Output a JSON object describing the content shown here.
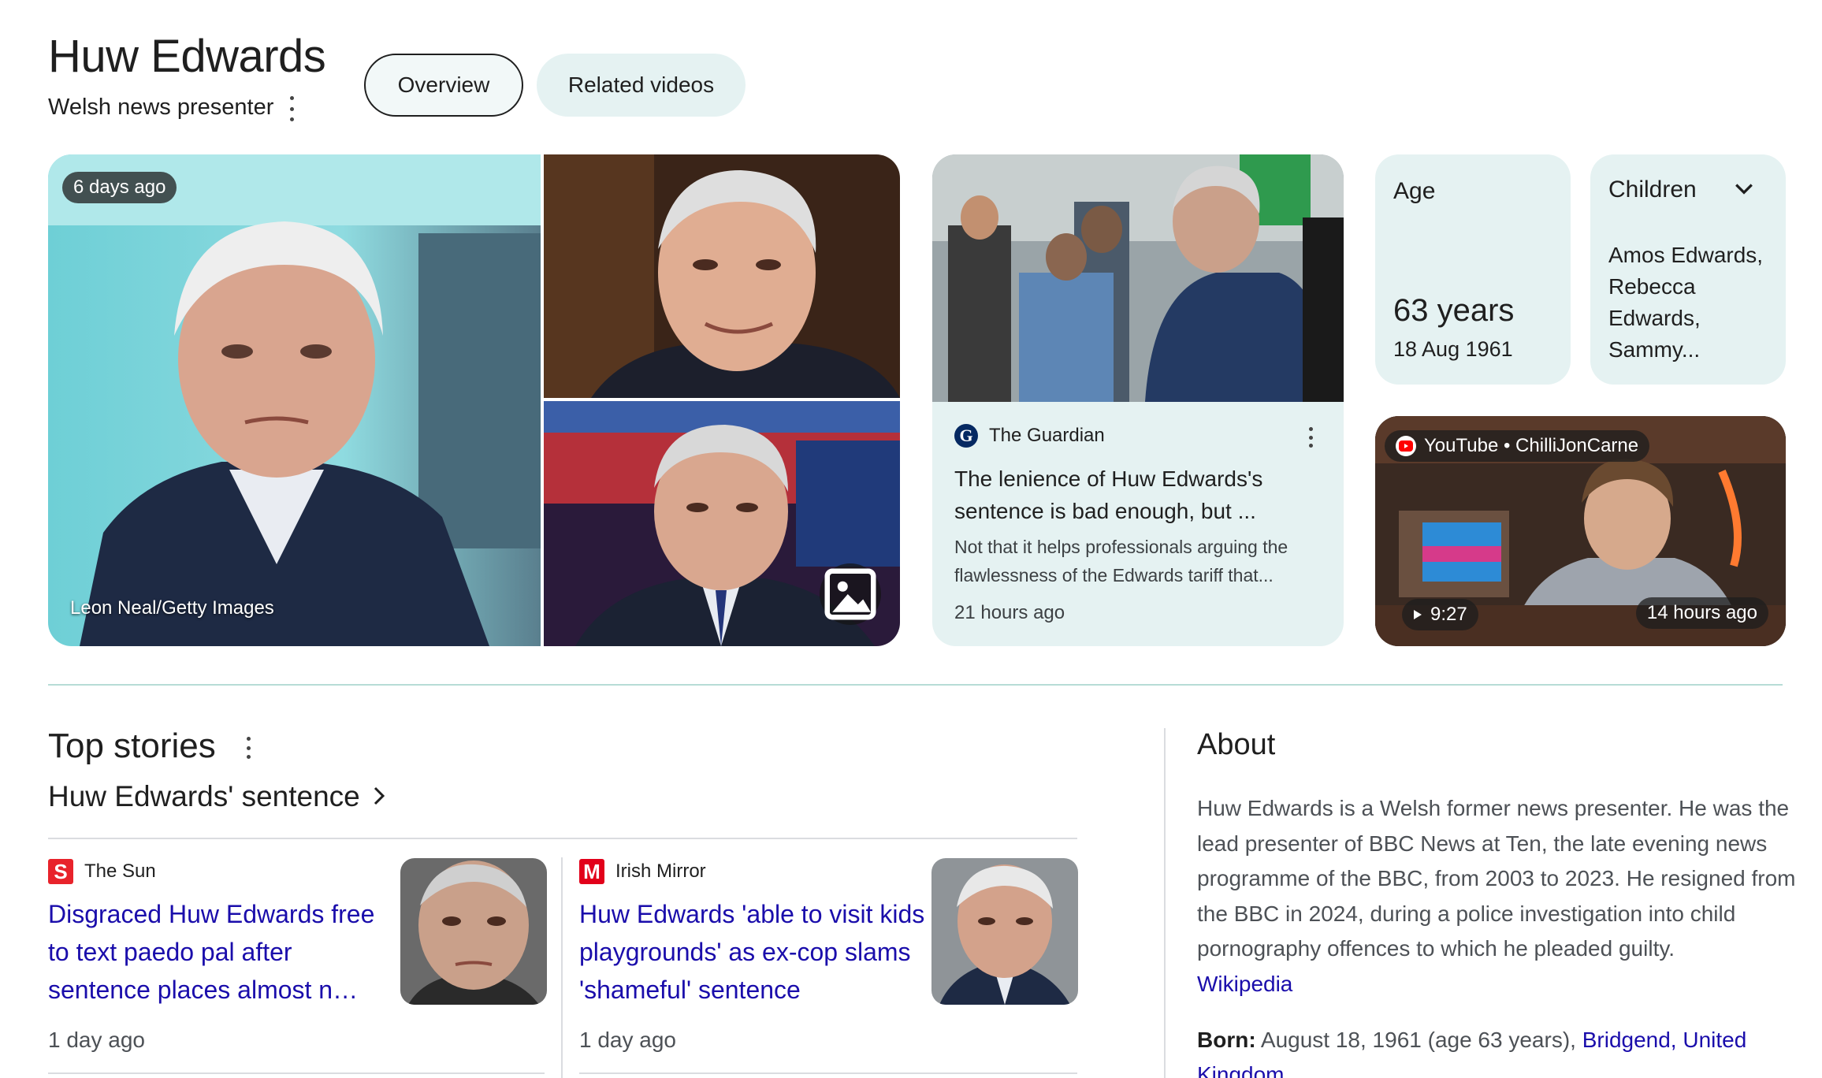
{
  "entity": {
    "title": "Huw Edwards",
    "subtitle": "Welsh news presenter"
  },
  "tabs": [
    {
      "label": "Overview",
      "active": true
    },
    {
      "label": "Related videos",
      "active": false
    }
  ],
  "images": {
    "main_badge": "6 days ago",
    "main_credit": "Leon Neal/Getty Images",
    "images_icon": "image-gallery-icon"
  },
  "news_card": {
    "source": "The Guardian",
    "title": "The lenience of Huw Edwards's sentence is bad enough, but ...",
    "snippet": "Not that it helps professionals arguing the flawlessness of the Edwards tariff that...",
    "time": "21 hours ago"
  },
  "facts": {
    "age_label": "Age",
    "age_value": "63 years",
    "age_dob": "18 Aug 1961",
    "children_label": "Children",
    "children_value": "Amos Edwards, Rebecca Edwards, Sammy..."
  },
  "video_card": {
    "source": "YouTube • ChilliJonCarne",
    "duration": "9:27",
    "time": "14 hours ago"
  },
  "top_stories": {
    "title": "Top stories",
    "topic": "Huw Edwards' sentence",
    "stories": [
      {
        "source": "The Sun",
        "title": "Disgraced Huw Edwards free to text paedo pal after sentence places almost n…",
        "time": "1 day ago"
      },
      {
        "source": "Irish Mirror",
        "title": "Huw Edwards 'able to visit kids playgrounds' as ex-cop slams 'shameful' sentence",
        "time": "1 day ago"
      }
    ]
  },
  "about": {
    "title": "About",
    "text": "Huw Edwards is a Welsh former news presenter. He was the lead presenter of BBC News at Ten, the late evening news programme of the BBC, from 2003 to 2023. He resigned from the BBC in 2024, during a police investigation into child pornography offences to which he pleaded guilty.",
    "source_link": "Wikipedia",
    "born_label": "Born:",
    "born_text": "August 18, 1961 (age 63 years),",
    "born_place": "Bridgend, United Kingdom"
  },
  "colors": {
    "accent_bg": "#e5f2f2",
    "link": "#1a0dab",
    "divider": "#b7dcd6"
  }
}
